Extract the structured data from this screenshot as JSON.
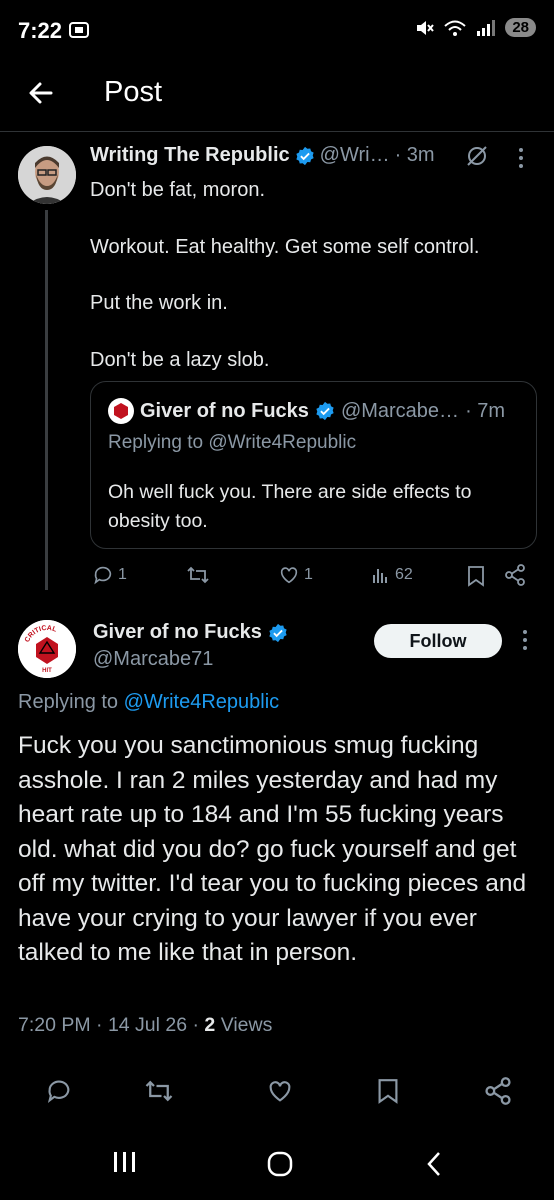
{
  "status_bar": {
    "time": "7:22",
    "battery": "28"
  },
  "header": {
    "title": "Post"
  },
  "parent_post": {
    "author": "Writing The Republic",
    "handle": "@Wri…",
    "time": "· 3m",
    "lines": [
      "Don't be fat, moron.",
      "Workout. Eat healthy. Get some self control.",
      "Put the work in.",
      "Don't be a lazy slob."
    ],
    "quoted": {
      "author": "Giver of no Fucks",
      "handle": "@Marcabe…",
      "time": "· 7m",
      "replying": "Replying to @Write4Republic",
      "text": "Oh well fuck you. There are side effects to obesity too."
    },
    "stats": {
      "replies": "1",
      "likes": "1",
      "views": "62"
    }
  },
  "main_post": {
    "author": "Giver of no Fucks",
    "handle": "@Marcabe71",
    "follow_label": "Follow",
    "replying_prefix": "Replying to ",
    "replying_handle": "@Write4Republic",
    "text": "Fuck you you sanctimonious smug fucking asshole. I ran 2 miles yesterday and had my heart rate up to 184 and I'm 55 fucking years old. what did you do? go fuck yourself and get off my twitter. I'd tear you to fucking pieces and have your crying to your lawyer if you ever talked to me like that in person.",
    "timestamp": "7:20 PM · 14 Jul 26 · ",
    "views_count": "2",
    "views_label": " Views"
  },
  "avatar_text": {
    "top": "CRITICAL",
    "bottom": "HIT"
  },
  "icons": [
    "back-arrow-icon",
    "verified-icon",
    "grok-icon",
    "more-icon",
    "reply-icon",
    "retweet-icon",
    "like-icon",
    "views-icon",
    "bookmark-icon",
    "share-icon",
    "recents-icon",
    "home-icon",
    "nav-back-icon"
  ],
  "colors": {
    "accent": "#1d9bf0",
    "background": "#000000",
    "muted": "#8b98a5"
  }
}
